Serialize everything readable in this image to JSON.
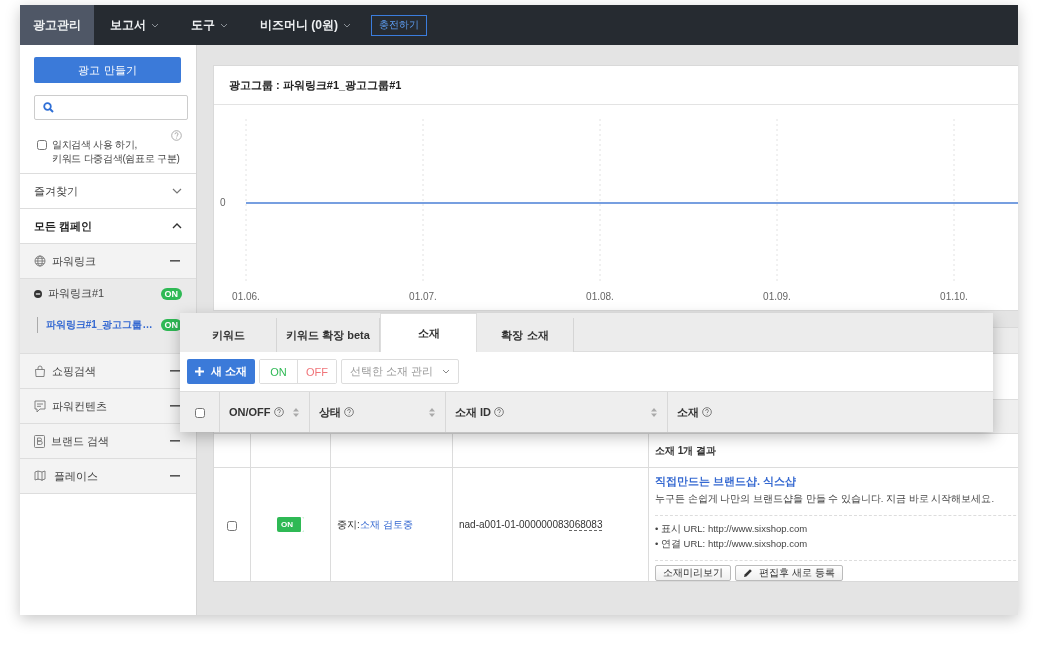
{
  "top_nav": {
    "items": [
      {
        "label": "광고관리",
        "selected": true,
        "dropdown": false
      },
      {
        "label": "보고서",
        "selected": false,
        "dropdown": true
      },
      {
        "label": "도구",
        "selected": false,
        "dropdown": true
      },
      {
        "label": "비즈머니 (0원)",
        "selected": false,
        "dropdown": true
      }
    ],
    "charge_button": "충전하기"
  },
  "sidebar": {
    "create_button": "광고 만들기",
    "exact_match": {
      "checked": false,
      "lines": [
        "일치검색 사용 하기,",
        "키워드 다중검색(쉼표로 구분)"
      ]
    },
    "favorites": {
      "label": "즐겨찾기",
      "expanded": false
    },
    "all_campaigns": {
      "label": "모든 캠페인",
      "expanded": true
    },
    "campaign_types": [
      {
        "label": "파워링크",
        "kind": "globe",
        "campaigns": [
          {
            "name": "파워링크#1",
            "status": "ON",
            "on": true,
            "ad_groups": [
              {
                "name": "파워링크#1_광고그룹…",
                "status": "ON",
                "on": true,
                "selected": true
              }
            ]
          }
        ]
      },
      {
        "label": "쇼핑검색",
        "kind": "bag"
      },
      {
        "label": "파워컨텐츠",
        "kind": "bubble"
      },
      {
        "label": "브랜드 검색",
        "kind": "brand"
      },
      {
        "label": "플레이스",
        "kind": "map"
      }
    ]
  },
  "ad_group": {
    "title": "광고그룹 : 파워링크#1_광고그룹#1",
    "chart": {
      "y_label": "0",
      "x_labels": [
        "01.06.",
        "01.07.",
        "01.08.",
        "01.09.",
        "01.10."
      ]
    }
  },
  "panel": {
    "tabs": [
      {
        "label": "키워드",
        "selected": false
      },
      {
        "label": "키워드 확장 beta",
        "selected": false
      },
      {
        "label": "소재",
        "selected": true
      },
      {
        "label": "확장 소재",
        "selected": false
      }
    ],
    "new_button": "새 소재",
    "on_button": "ON",
    "off_button": "OFF",
    "manage_select": "선택한 소재 관리",
    "select_all": {
      "checked": false
    },
    "columns": [
      {
        "label": "ON/OFF",
        "sortable": true
      },
      {
        "label": "상태",
        "sortable": true
      },
      {
        "label": "소재 ID",
        "sortable": true
      },
      {
        "label": "소재",
        "sortable": false
      }
    ]
  },
  "ads_table": {
    "result_summary": "소재 1개 결과",
    "rows": [
      {
        "checked": false,
        "on": true,
        "switch_label": "ON",
        "status_prefix": "중지:",
        "status_link": "소재 검토중",
        "id_prefix": "nad-a001-01-000000083",
        "id_suffix": "068083",
        "headline": "직접만드는 브랜드샵. 식스샵",
        "description": "누구든 손쉽게 나만의 브랜드샵을 만들 수 있습니다. 지금 바로 시작해보세요.",
        "urls": [
          "• 표시 URL: http://www.sixshop.com",
          "• 연결 URL: http://www.sixshop.com"
        ],
        "preview_button": "소재미리보기",
        "edit_button": "편집후 새로 등록"
      }
    ]
  }
}
